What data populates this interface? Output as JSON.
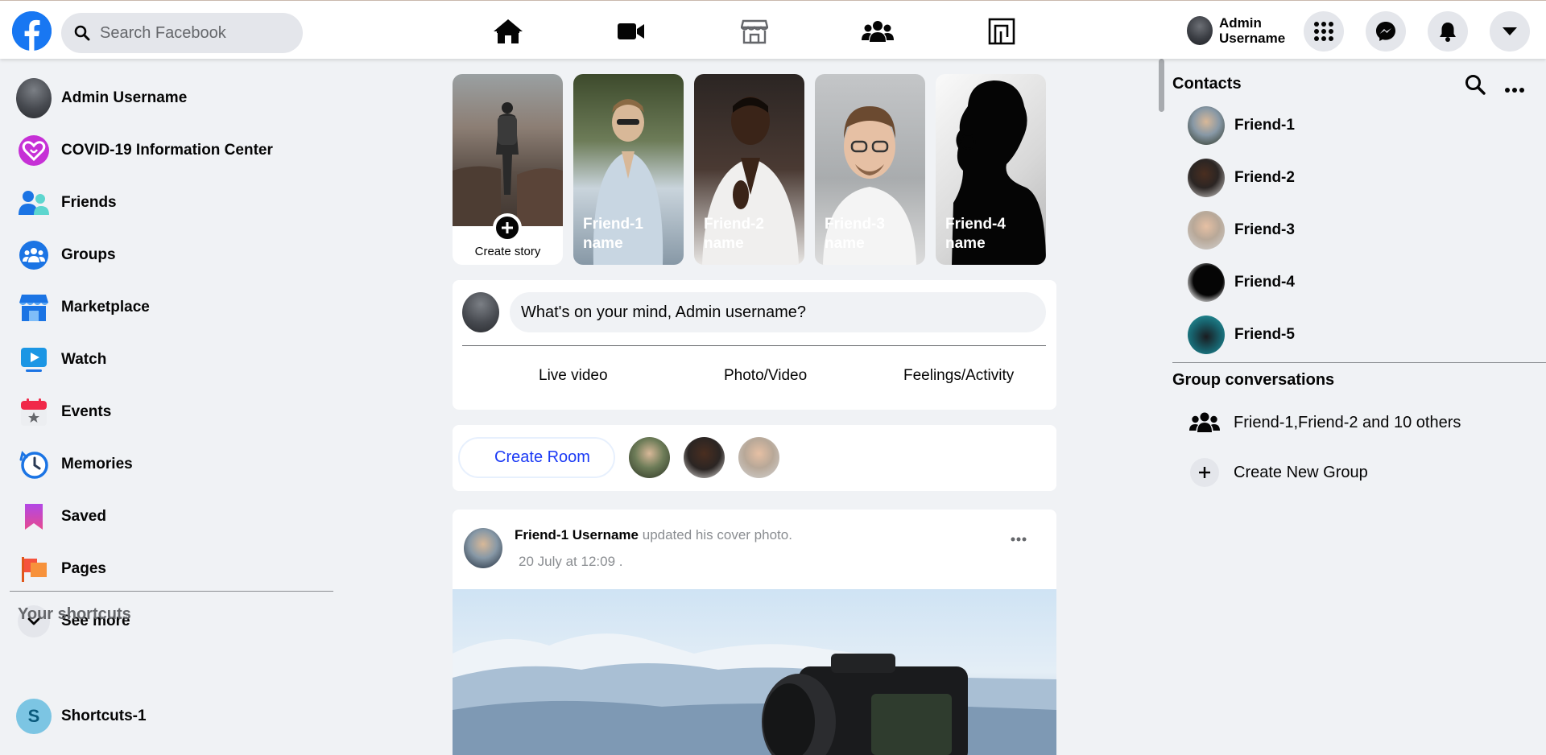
{
  "search": {
    "placeholder": "Search Facebook"
  },
  "nav_icons": [
    "home-icon",
    "video-icon",
    "marketplace-icon",
    "groups-icon",
    "gaming-icon"
  ],
  "topbar": {
    "user_name": "Admin Username"
  },
  "sidebar": {
    "items": [
      {
        "label": "Admin Username",
        "icon": "avatar"
      },
      {
        "label": "COVID-19 Information Center",
        "icon": "covid-heart-icon"
      },
      {
        "label": "Friends",
        "icon": "friends-icon"
      },
      {
        "label": "Groups",
        "icon": "groups-icon"
      },
      {
        "label": "Marketplace",
        "icon": "marketplace-icon"
      },
      {
        "label": "Watch",
        "icon": "watch-icon"
      },
      {
        "label": "Events",
        "icon": "events-icon"
      },
      {
        "label": "Memories",
        "icon": "memories-icon"
      },
      {
        "label": "Saved",
        "icon": "saved-icon"
      },
      {
        "label": "Pages",
        "icon": "pages-icon"
      },
      {
        "label": "See more",
        "icon": "chevron-down-icon"
      }
    ],
    "shortcuts_title": "Your shortcuts",
    "shortcuts": [
      {
        "label": "Shortcuts-1",
        "letter": "S"
      }
    ]
  },
  "stories": {
    "create_label": "Create story",
    "items": [
      {
        "name": "Friend-1 name"
      },
      {
        "name": "Friend-2 name"
      },
      {
        "name": "Friend-3 name"
      },
      {
        "name": "Friend-4 name"
      }
    ]
  },
  "composer": {
    "placeholder": "What's on your mind, Admin username?",
    "actions": [
      "Live video",
      "Photo/Video",
      "Feelings/Activity"
    ]
  },
  "rooms": {
    "create_label": "Create Room"
  },
  "post": {
    "author": "Friend-1 Username",
    "action": "updated his cover photo.",
    "time": "20 July at 12:09  ."
  },
  "contacts": {
    "title": "Contacts",
    "items": [
      "Friend-1",
      "Friend-2",
      "Friend-3",
      "Friend-4",
      "Friend-5"
    ]
  },
  "group_conversations": {
    "title": "Group conversations",
    "items": [
      {
        "label": "Friend-1,Friend-2 and 10 others",
        "icon": "group-icon"
      },
      {
        "label": "Create New Group",
        "icon": "plus-icon"
      }
    ]
  },
  "colors": {
    "brand_blue": "#1877f2",
    "background": "#f0f2f5",
    "create_room_text": "#1b3af5"
  }
}
